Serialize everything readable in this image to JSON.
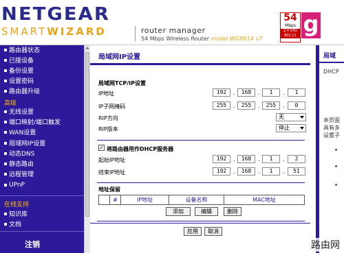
{
  "header": {
    "brand": "NETGEAR",
    "brand_sub_a": "SMART",
    "brand_sub_b": "WIZARD",
    "title": "router manager",
    "subtitle": "54 Mbps Wireless Router",
    "model": "model WGR614 v7",
    "badge_num": "54",
    "badge_unit": "Mbps",
    "badge_freq": "2.4 GHz 802.11",
    "badge_g": "g"
  },
  "sidebar": {
    "items_top": [
      "路由器状态",
      "已接设备",
      "备份设置",
      "设置密码",
      "路由器升级"
    ],
    "group_advanced": "高级",
    "items_adv": [
      "无线设置",
      "端口映射/端口触发",
      "WAN设置",
      "局域网IP设置",
      "动态DNS",
      "静态路由",
      "远程管理",
      "UPnP"
    ],
    "group_support": "在线支持",
    "items_support": [
      "知识库",
      "文档"
    ],
    "logout": "注销"
  },
  "main": {
    "title": "局域网IP设置",
    "tcpip_title": "局域网TCP/IP设置",
    "ip_label": "IP地址",
    "ip": [
      "192",
      "168",
      "1",
      "1"
    ],
    "mask_label": "IP子网掩码",
    "mask": [
      "255",
      "255",
      "255",
      "0"
    ],
    "rip_dir_label": "RIP方向",
    "rip_dir_value": "无",
    "rip_ver_label": "RIP版本",
    "rip_ver_value": "停止",
    "dhcp_label": "将路由器用作DHCP服务器",
    "start_label": "起始IP地址",
    "start_ip": [
      "192",
      "168",
      "1",
      "2"
    ],
    "end_label": "结束IP地址",
    "end_ip": [
      "192",
      "168",
      "1",
      "51"
    ],
    "reserve_title": "地址保留",
    "reserve_cols": [
      "#",
      "IP地址",
      "设备名称",
      "MAC地址"
    ],
    "btn_add": "添加",
    "btn_edit": "编辑",
    "btn_delete": "删除",
    "btn_apply": "应用",
    "btn_cancel": "取消"
  },
  "help": {
    "title": "局域",
    "line1": "DHCP",
    "line2": "本页面",
    "line3": "具有多",
    "line4": "设置子"
  },
  "watermark": "路由网",
  "colors": {
    "sidebar": "#2c1a9a",
    "accent": "#e8a317",
    "badge_red": "#c00000",
    "badge_pink": "#d6207a"
  }
}
